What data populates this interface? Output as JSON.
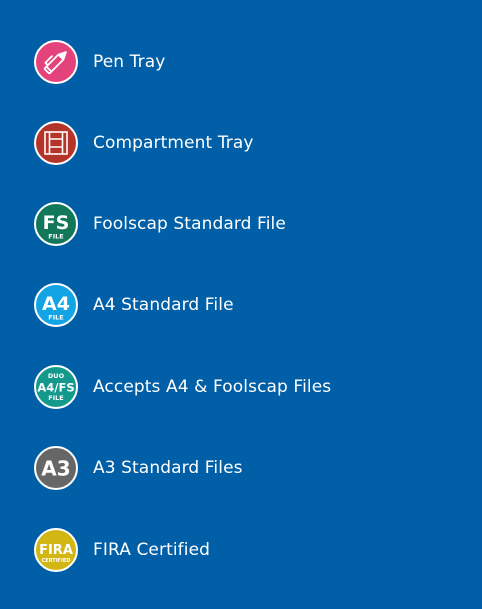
{
  "legend": {
    "items": [
      {
        "label": "Pen Tray",
        "icon": "pen-icon",
        "color": "#e3427b"
      },
      {
        "label": "Compartment Tray",
        "icon": "compartment-tray-icon",
        "color": "#b4342a"
      },
      {
        "label": "Foolscap Standard File",
        "icon": "fs-file-icon",
        "color": "#13785a",
        "badge_text": "FS",
        "badge_subtext": "FILE"
      },
      {
        "label": "A4 Standard File",
        "icon": "a4-file-icon",
        "color": "#12a4e4",
        "badge_text": "A4",
        "badge_subtext": "FILE"
      },
      {
        "label": "Accepts A4 & Foolscap Files",
        "icon": "duo-a4-fs-file-icon",
        "color": "#149a8d",
        "badge_pretext": "DUO",
        "badge_text": "A4/FS",
        "badge_subtext": "FILE"
      },
      {
        "label": "A3 Standard Files",
        "icon": "a3-file-icon",
        "color": "#666666",
        "badge_text": "A3"
      },
      {
        "label": "FIRA Certified",
        "icon": "fira-certified-icon",
        "color": "#d1b614",
        "badge_text": "FIRA",
        "badge_subtext": "CERTIFIED"
      }
    ]
  }
}
